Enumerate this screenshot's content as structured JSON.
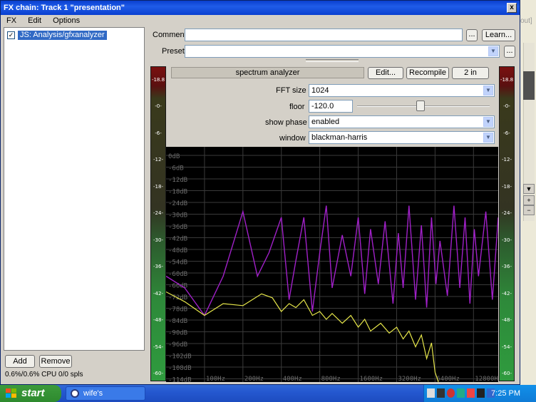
{
  "window": {
    "title": "FX chain: Track 1 \"presentation\"",
    "close_label": "x"
  },
  "menu": [
    "FX",
    "Edit",
    "Options"
  ],
  "fx_list": {
    "items": [
      {
        "label": "JS: Analysis/gfxanalyzer",
        "checked": true
      }
    ],
    "add_label": "Add",
    "remove_label": "Remove",
    "status": "0.6%/0.6% CPU 0/0 spls"
  },
  "comment": {
    "label": "Comment",
    "value": "",
    "browse_label": "...",
    "learn_label": "Learn..."
  },
  "preset": {
    "label": "Preset",
    "value": "",
    "more_label": "..."
  },
  "plugin": {
    "name": "spectrum analyzer",
    "edit_label": "Edit...",
    "recompile_label": "Recompile",
    "io_label": "2 in"
  },
  "params": {
    "fft_size": {
      "label": "FFT size",
      "value": "1024"
    },
    "floor": {
      "label": "floor",
      "value": "-120.0",
      "slider_fraction": 0.48
    },
    "show_phase": {
      "label": "show phase",
      "value": "enabled"
    },
    "window": {
      "label": "window",
      "value": "blackman-harris"
    }
  },
  "meter_ticks": [
    "-18.8",
    "-0-",
    "-6-",
    "-12-",
    "-18-",
    "-24-",
    "-30-",
    "-36-",
    "-42-",
    "-48-",
    "-54-",
    "-60-"
  ],
  "chart_data": {
    "type": "line",
    "x_tick_labels": [
      "100Hz",
      "200Hz",
      "400Hz",
      "800Hz",
      "1600Hz",
      "3200Hz",
      "6400Hz",
      "12800Hz"
    ],
    "y_tick_labels": [
      "0dB",
      "-6dB",
      "-12dB",
      "-18dB",
      "-24dB",
      "-30dB",
      "-36dB",
      "-42dB",
      "-48dB",
      "-54dB",
      "-60dB",
      "-66dB",
      "-72dB",
      "-78dB",
      "-84dB",
      "-90dB",
      "-96dB",
      "-102dB",
      "-108dB",
      "-114dB"
    ],
    "y_range_db": [
      -120,
      0
    ],
    "x_range_hz": [
      50,
      20000
    ],
    "grid": true,
    "colors": {
      "background": "#000000",
      "grid": "#3a3a3a",
      "labels": "#6e6e6e",
      "phase": "#a020c8",
      "magnitude": "#e6e64a"
    },
    "series": [
      {
        "color": "#a020c8",
        "points": [
          [
            50,
            -66
          ],
          [
            70,
            -72
          ],
          [
            100,
            -86
          ],
          [
            140,
            -66
          ],
          [
            200,
            -33
          ],
          [
            260,
            -66
          ],
          [
            320,
            -54
          ],
          [
            400,
            -36
          ],
          [
            460,
            -78
          ],
          [
            520,
            -58
          ],
          [
            600,
            -36
          ],
          [
            700,
            -84
          ],
          [
            800,
            -54
          ],
          [
            900,
            -30
          ],
          [
            1000,
            -72
          ],
          [
            1200,
            -45
          ],
          [
            1400,
            -66
          ],
          [
            1600,
            -36
          ],
          [
            1800,
            -75
          ],
          [
            2000,
            -42
          ],
          [
            2300,
            -70
          ],
          [
            2600,
            -38
          ],
          [
            3000,
            -80
          ],
          [
            3300,
            -44
          ],
          [
            3600,
            -72
          ],
          [
            4000,
            -30
          ],
          [
            4500,
            -78
          ],
          [
            5000,
            -40
          ],
          [
            5500,
            -82
          ],
          [
            6000,
            -36
          ],
          [
            6500,
            -70
          ],
          [
            7000,
            -48
          ],
          [
            8000,
            -76
          ],
          [
            9000,
            -30
          ],
          [
            10000,
            -72
          ],
          [
            11000,
            -36
          ],
          [
            12000,
            -80
          ],
          [
            13000,
            -42
          ],
          [
            14000,
            -66
          ],
          [
            16000,
            -33
          ],
          [
            18000,
            -78
          ],
          [
            20000,
            -36
          ]
        ]
      },
      {
        "color": "#e6e64a",
        "points": [
          [
            50,
            -74
          ],
          [
            70,
            -79
          ],
          [
            100,
            -86
          ],
          [
            140,
            -80
          ],
          [
            200,
            -81
          ],
          [
            280,
            -75
          ],
          [
            340,
            -77
          ],
          [
            400,
            -84
          ],
          [
            460,
            -80
          ],
          [
            520,
            -82
          ],
          [
            600,
            -78
          ],
          [
            700,
            -86
          ],
          [
            800,
            -84
          ],
          [
            900,
            -88
          ],
          [
            1000,
            -85
          ],
          [
            1200,
            -90
          ],
          [
            1400,
            -86
          ],
          [
            1600,
            -92
          ],
          [
            1800,
            -88
          ],
          [
            2000,
            -94
          ],
          [
            2400,
            -90
          ],
          [
            2800,
            -95
          ],
          [
            3200,
            -92
          ],
          [
            3600,
            -98
          ],
          [
            4000,
            -94
          ],
          [
            4500,
            -102
          ],
          [
            5000,
            -96
          ],
          [
            5500,
            -108
          ],
          [
            6000,
            -100
          ],
          [
            6400,
            -115
          ],
          [
            6800,
            -120
          ]
        ]
      }
    ]
  },
  "taskbar": {
    "start_label": "start",
    "task_label": "wife's presentati...",
    "clock": "7:25 PM"
  },
  "background_app": {
    "text": "out]"
  }
}
